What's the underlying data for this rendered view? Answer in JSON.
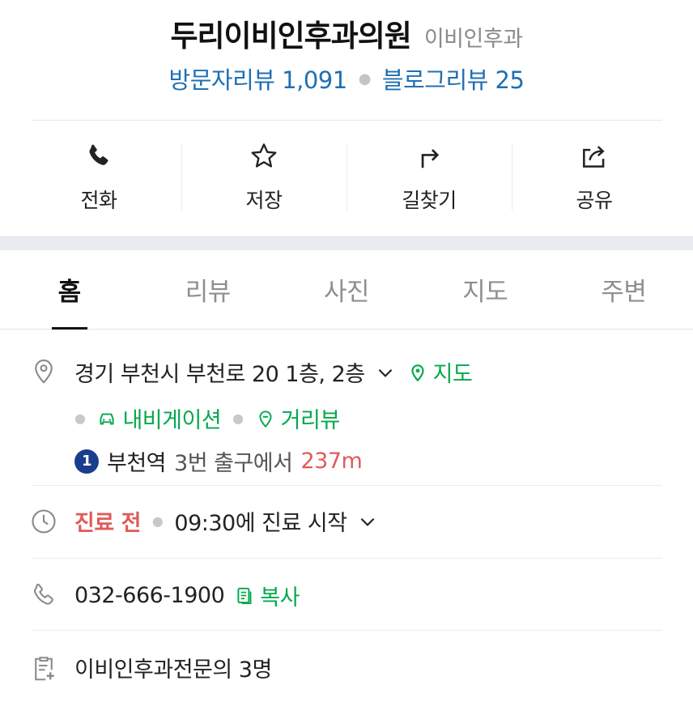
{
  "header": {
    "place_name": "두리이비인후과의원",
    "category": "이비인후과",
    "visitor_review": "방문자리뷰 1,091",
    "blog_review": "블로그리뷰 25"
  },
  "actions": {
    "call": "전화",
    "save": "저장",
    "directions": "길찾기",
    "share": "공유"
  },
  "tabs": [
    "홈",
    "리뷰",
    "사진",
    "지도",
    "주변"
  ],
  "address": {
    "text": "경기 부천시 부천로 20 1층, 2층",
    "map_link": "지도",
    "navigation_link": "내비게이션",
    "street_view_link": "거리뷰",
    "station_number": "1",
    "station_name": "부천역",
    "exit_text": "3번 출구에서",
    "distance": "237m"
  },
  "hours": {
    "status": "진료 전",
    "detail": "09:30에 진료 시작"
  },
  "phone": {
    "number": "032-666-1900",
    "copy_label": "복사"
  },
  "doctors": {
    "text": "이비인후과전문의 3명"
  },
  "colors": {
    "accent_green": "#03a94c",
    "review_blue": "#1f6fb3",
    "status_red": "#e05b5b",
    "station_line_1": "#1b3d8f"
  }
}
